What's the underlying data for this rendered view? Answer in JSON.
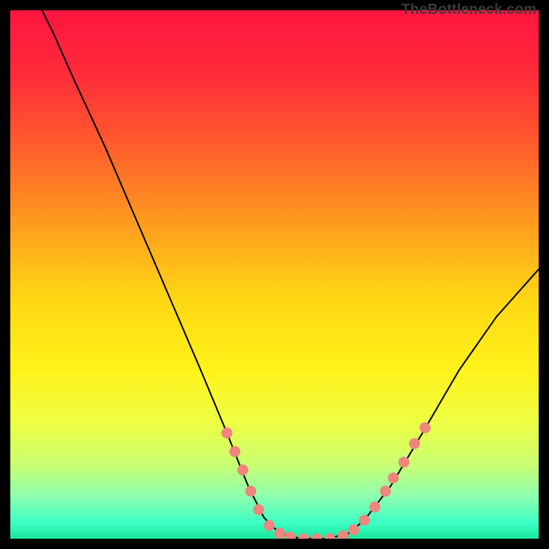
{
  "attribution": "TheBottleneck.com",
  "chart_data": {
    "type": "line",
    "title": "",
    "xlabel": "",
    "ylabel": "",
    "xlim": [
      0,
      100
    ],
    "ylim": [
      0,
      100
    ],
    "background_gradient": {
      "stops": [
        {
          "offset": 0,
          "color": "#ff153f"
        },
        {
          "offset": 12,
          "color": "#ff2b3a"
        },
        {
          "offset": 25,
          "color": "#ff5a2c"
        },
        {
          "offset": 40,
          "color": "#ff9a1f"
        },
        {
          "offset": 55,
          "color": "#ffd814"
        },
        {
          "offset": 68,
          "color": "#fff21a"
        },
        {
          "offset": 78,
          "color": "#eeff44"
        },
        {
          "offset": 86,
          "color": "#c9ff73"
        },
        {
          "offset": 92,
          "color": "#8dffb0"
        },
        {
          "offset": 97,
          "color": "#3dffc4"
        },
        {
          "offset": 100,
          "color": "#19e79d"
        }
      ]
    },
    "series": [
      {
        "name": "bottleneck-curve",
        "points": [
          {
            "x": 6.0,
            "y": 100.0
          },
          {
            "x": 8.0,
            "y": 96.0
          },
          {
            "x": 12.0,
            "y": 87.0
          },
          {
            "x": 18.0,
            "y": 74.0
          },
          {
            "x": 24.0,
            "y": 60.0
          },
          {
            "x": 30.0,
            "y": 46.0
          },
          {
            "x": 36.0,
            "y": 32.0
          },
          {
            "x": 41.0,
            "y": 20.0
          },
          {
            "x": 45.0,
            "y": 10.0
          },
          {
            "x": 48.0,
            "y": 4.0
          },
          {
            "x": 51.0,
            "y": 1.0
          },
          {
            "x": 55.0,
            "y": 0.0
          },
          {
            "x": 60.0,
            "y": 0.0
          },
          {
            "x": 64.0,
            "y": 1.0
          },
          {
            "x": 67.0,
            "y": 3.5
          },
          {
            "x": 72.0,
            "y": 10.0
          },
          {
            "x": 78.0,
            "y": 20.0
          },
          {
            "x": 85.0,
            "y": 32.0
          },
          {
            "x": 92.0,
            "y": 42.0
          },
          {
            "x": 100.0,
            "y": 51.0
          }
        ]
      }
    ],
    "markers": {
      "name": "highlight-dots",
      "color": "#ef857d",
      "radius": 8,
      "points": [
        {
          "x": 41.0,
          "y": 20.0
        },
        {
          "x": 42.5,
          "y": 16.5
        },
        {
          "x": 44.0,
          "y": 13.0
        },
        {
          "x": 45.5,
          "y": 9.0
        },
        {
          "x": 47.0,
          "y": 5.5
        },
        {
          "x": 49.0,
          "y": 2.5
        },
        {
          "x": 51.0,
          "y": 1.0
        },
        {
          "x": 53.0,
          "y": 0.3
        },
        {
          "x": 55.5,
          "y": 0.0
        },
        {
          "x": 58.0,
          "y": 0.0
        },
        {
          "x": 60.5,
          "y": 0.0
        },
        {
          "x": 63.0,
          "y": 0.5
        },
        {
          "x": 65.0,
          "y": 1.7
        },
        {
          "x": 67.0,
          "y": 3.5
        },
        {
          "x": 69.0,
          "y": 6.0
        },
        {
          "x": 71.0,
          "y": 9.0
        },
        {
          "x": 72.5,
          "y": 11.5
        },
        {
          "x": 74.5,
          "y": 14.5
        },
        {
          "x": 76.5,
          "y": 18.0
        },
        {
          "x": 78.5,
          "y": 21.0
        }
      ]
    }
  }
}
